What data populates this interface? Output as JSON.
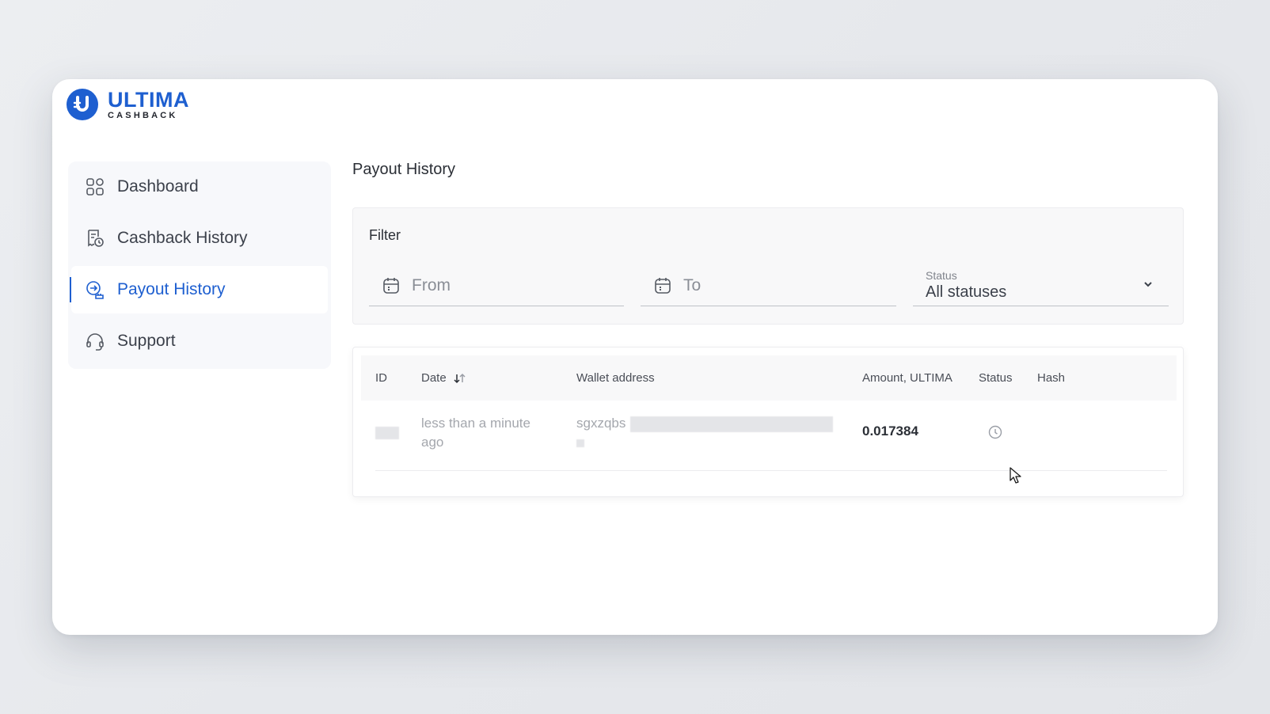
{
  "brand": {
    "title": "ULTIMA",
    "subtitle": "CASHBACK",
    "accent": "#1e5fd0"
  },
  "sidebar": {
    "items": [
      {
        "label": "Dashboard",
        "icon": "grid-icon",
        "active": false
      },
      {
        "label": "Cashback History",
        "icon": "receipt-clock-icon",
        "active": false
      },
      {
        "label": "Payout History",
        "icon": "payout-icon",
        "active": true
      },
      {
        "label": "Support",
        "icon": "headset-icon",
        "active": false
      }
    ]
  },
  "main": {
    "title": "Payout History",
    "filter": {
      "title": "Filter",
      "from_placeholder": "From",
      "to_placeholder": "To",
      "status_label": "Status",
      "status_value": "All statuses"
    },
    "table": {
      "columns": [
        "ID",
        "Date",
        "Wallet address",
        "Amount, ULTIMA",
        "Status",
        "Hash"
      ],
      "rows": [
        {
          "id": "",
          "date": "less than a minute ago",
          "wallet": "sgxzqbs",
          "amount": "0.017384",
          "status_icon": "clock-icon",
          "hash": ""
        }
      ]
    }
  }
}
